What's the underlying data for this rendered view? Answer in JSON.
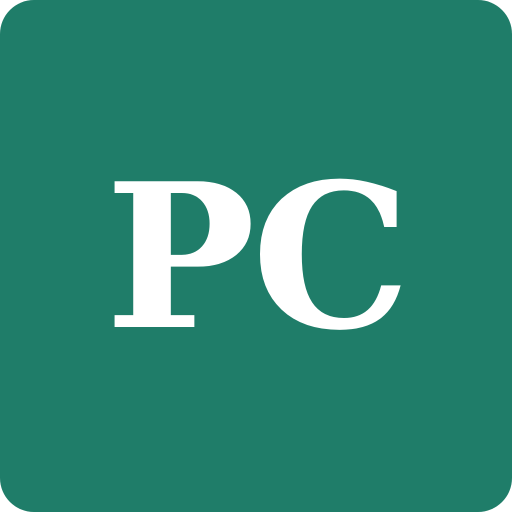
{
  "icon": {
    "monogram": "PC",
    "background_color": "#1f7d69",
    "text_color": "#ffffff"
  }
}
